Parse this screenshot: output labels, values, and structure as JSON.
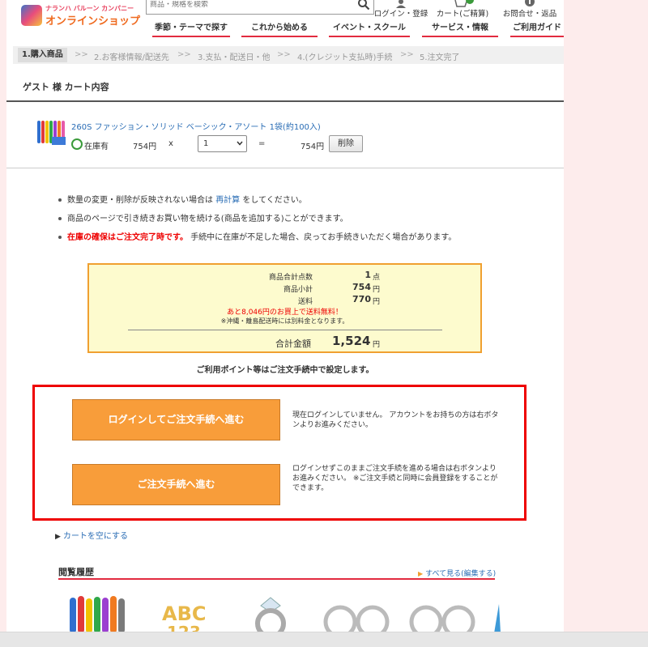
{
  "header": {
    "logo_small": "ナランハ バルーン カンパニー",
    "logo_main": "オンラインショップ",
    "search_placeholder": "商品・規格を検索",
    "login_label": "ログイン・登録",
    "cart_label": "カート(ご精算)",
    "contact_label": "お問合せ・返品"
  },
  "nav": {
    "items": [
      "季節・テーマで探す",
      "これから始める",
      "イベント・スクール",
      "サービス・情報",
      "ご利用ガイド"
    ]
  },
  "steps": {
    "items": [
      "1.購入商品",
      "2.お客様情報/配送先",
      "3.支払・配送日・他",
      "4.(クレジット支払時)手続",
      "5.注文完了"
    ],
    "separator": ">>"
  },
  "cart": {
    "title": "ゲスト 様 カート内容",
    "item": {
      "name": "260S ファッション・ソリッド ベーシック・アソート 1袋(約100入)",
      "stock": "在庫有",
      "unit_price": "754円",
      "times": "x",
      "qty": "1",
      "equals": "=",
      "line_total": "754円",
      "delete_label": "削除"
    }
  },
  "notes": {
    "n1_pre": "数量の変更・削除が反映されない場合は",
    "n1_link": "再計算",
    "n1_post": "をしてください。",
    "n2": "商品のページで引き続きお買い物を続ける(商品を追加する)ことができます。",
    "n3_warn": "在庫の確保はご注文完了時です。",
    "n3_post": "手続中に在庫が不足した場合、戻ってお手続きいただく場合があります。"
  },
  "summary": {
    "count_label": "商品合計点数",
    "count_value": "1",
    "count_unit": "点",
    "subtotal_label": "商品小計",
    "subtotal_value": "754",
    "subtotal_unit": "円",
    "shipping_label": "送料",
    "shipping_value": "770",
    "shipping_unit": "円",
    "free_shipping_note": "あと8,046円のお買上で送料無料！",
    "island_note": "※沖縄・離島配送時には別料金となります。",
    "total_label": "合計金額",
    "total_value": "1,524",
    "total_unit": "円"
  },
  "points_note": "ご利用ポイント等はご注文手続中で設定します。",
  "checkout": {
    "login_button": "ログインしてご注文手続へ進む",
    "login_desc": "現在ログインしていません。 アカウントをお持ちの方は右ボタンよりお進みください。",
    "guest_button": "ご注文手続へ進む",
    "guest_desc": "ログインせずこのままご注文手続を進める場合は右ボタンよりお進みください。 ※ご注文手続と同時に会員登録をすることができます。"
  },
  "empty_cart": "カートを空にする",
  "history": {
    "title": "閲覧履歴",
    "see_all": "すべて見る(編集する)"
  },
  "colors": {
    "nav_underline": "#e22b3f",
    "link": "#2a6db5",
    "warning": "#e00000",
    "summary_bg": "#fdfbce",
    "summary_border": "#f0a030",
    "button_orange": "#f89d3a",
    "highlight_border": "#e00000"
  }
}
